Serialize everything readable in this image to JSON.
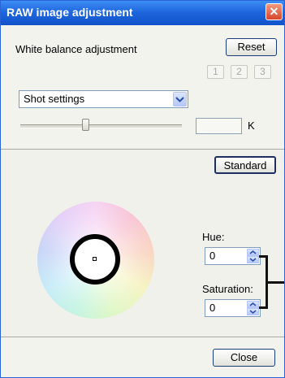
{
  "window": {
    "title": "RAW image adjustment",
    "close_symbol": "✕"
  },
  "white_balance": {
    "label": "White balance adjustment",
    "reset_label": "Reset",
    "presets": [
      "1",
      "2",
      "3"
    ],
    "select_value": "Shot settings",
    "kelvin_value": "",
    "kelvin_unit": "K"
  },
  "color_adjust": {
    "standard_label": "Standard",
    "hue_label": "Hue:",
    "hue_value": "0",
    "saturation_label": "Saturation:",
    "saturation_value": "0"
  },
  "footer": {
    "close_label": "Close"
  }
}
